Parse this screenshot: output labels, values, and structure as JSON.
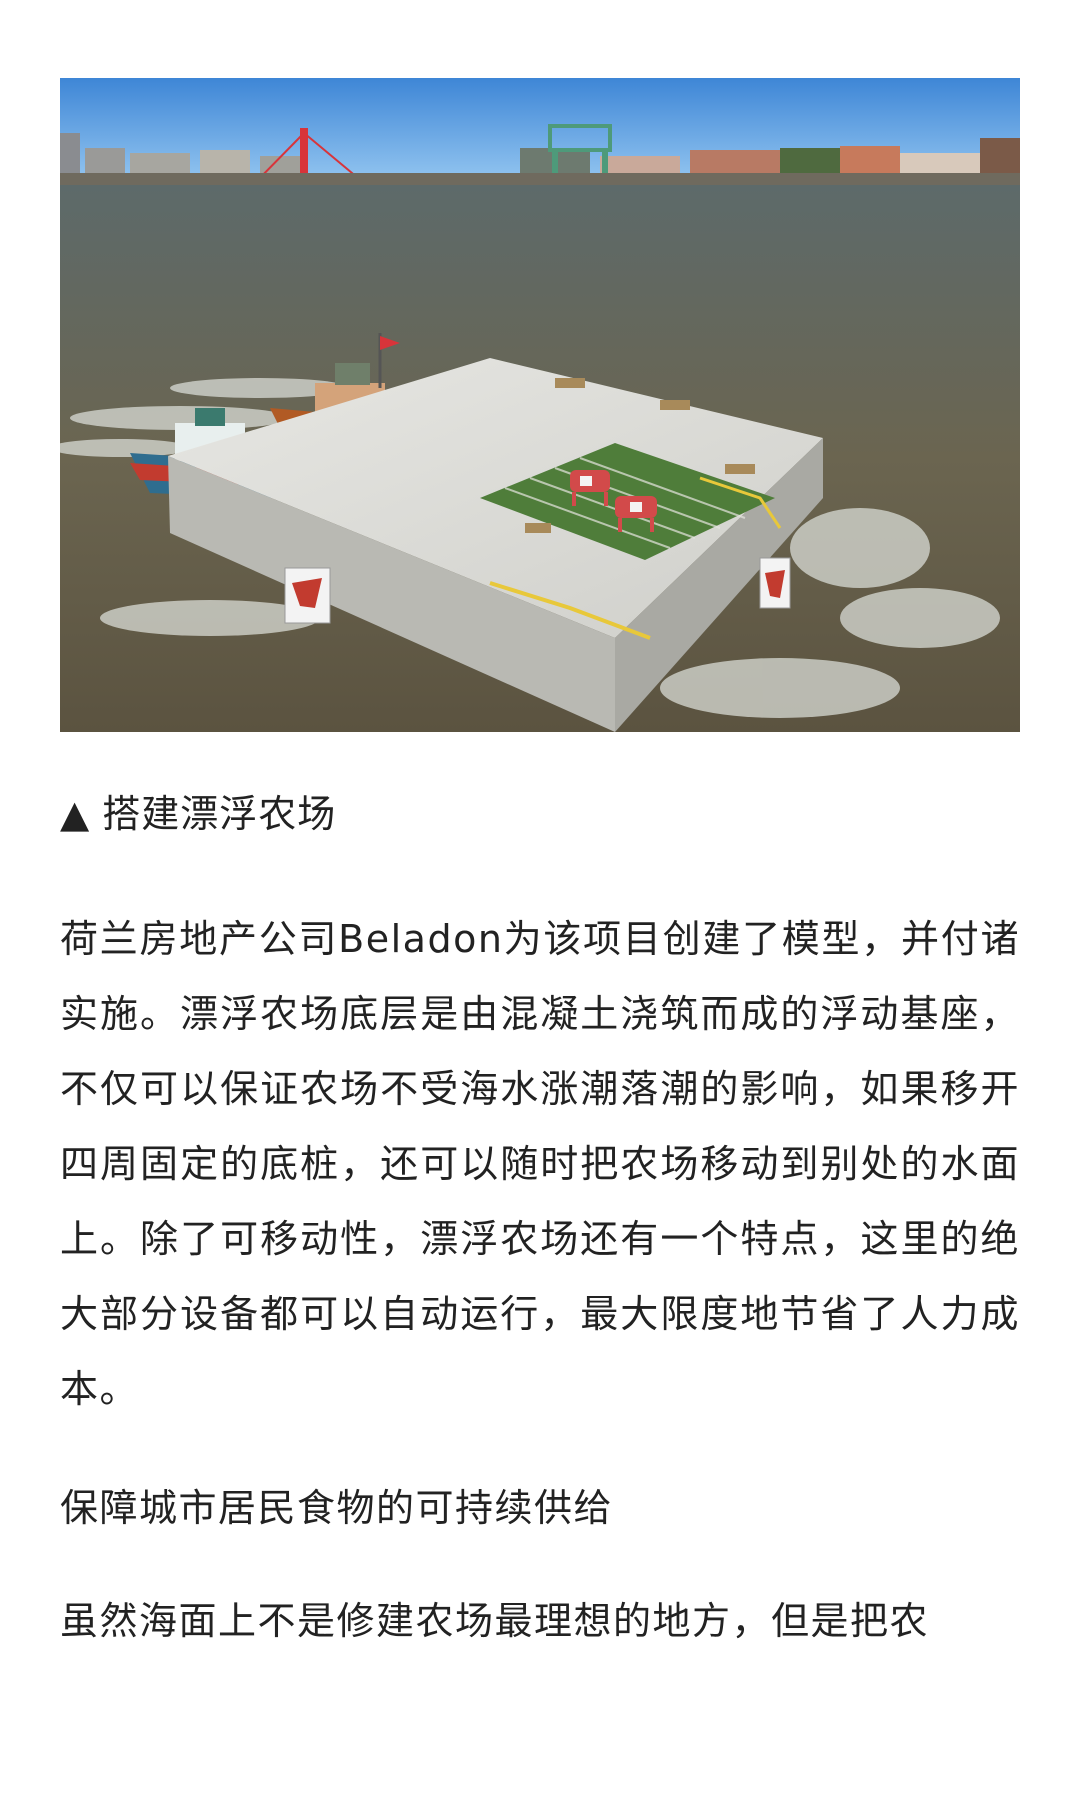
{
  "photo": {
    "description_icon": "floating-farm-photo"
  },
  "caption": {
    "marker": "▲",
    "text": "搭建漂浮农场"
  },
  "paragraphs": {
    "p1": "荷兰房地产公司Beladon为该项目创建了模型，并付诸实施。漂浮农场底层是由混凝土浇筑而成的浮动基座，不仅可以保证农场不受海水涨潮落潮的影响，如果移开四周固定的底桩，还可以随时把农场移动到别处的水面上。除了可移动性，漂浮农场还有一个特点，这里的绝大部分设备都可以自动运行，最大限度地节省了人力成本。",
    "subheading": "保障城市居民食物的可持续供给",
    "p2": "虽然海面上不是修建农场最理想的地方，但是把农"
  },
  "colors": {
    "text": "#222222",
    "background": "#ffffff"
  }
}
